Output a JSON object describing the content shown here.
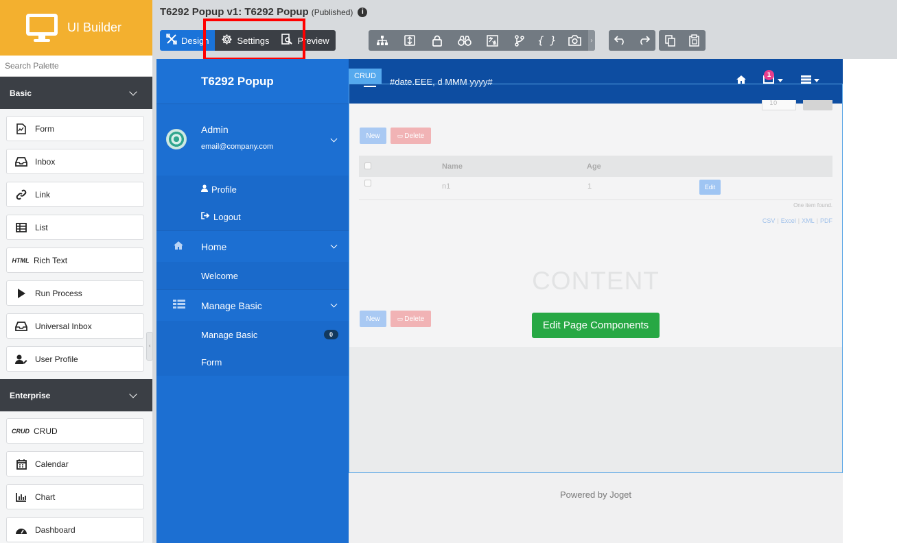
{
  "app": {
    "name": "UI Builder"
  },
  "header": {
    "title": "T6292 Popup v1: T6292 Popup",
    "status": "(Published)",
    "modes": [
      {
        "label": "Design",
        "icon": "design-icon",
        "active": true
      },
      {
        "label": "Settings",
        "icon": "gear-icon",
        "active": false
      },
      {
        "label": "Preview",
        "icon": "preview-icon",
        "active": false
      }
    ],
    "tools": [
      "tree-icon",
      "properties-icon",
      "permission-icon",
      "binoculars-icon",
      "translate-icon",
      "branch-icon",
      "json-icon",
      "screenshot-icon"
    ],
    "history": [
      "undo-icon",
      "redo-icon"
    ],
    "clipboard": [
      "copy-icon",
      "paste-icon"
    ]
  },
  "palette": {
    "search_placeholder": "Search Palette",
    "categories": [
      {
        "name": "Basic",
        "items": [
          {
            "label": "Form",
            "icon": "form-icon"
          },
          {
            "label": "Inbox",
            "icon": "inbox-icon"
          },
          {
            "label": "Link",
            "icon": "link-icon"
          },
          {
            "label": "List",
            "icon": "list-icon"
          },
          {
            "label": "Rich Text",
            "icon": "HTML"
          },
          {
            "label": "Run Process",
            "icon": "play-icon"
          },
          {
            "label": "Universal Inbox",
            "icon": "inbox-icon"
          },
          {
            "label": "User Profile",
            "icon": "user-edit-icon"
          }
        ]
      },
      {
        "name": "Enterprise",
        "items": [
          {
            "label": "CRUD",
            "icon": "CRUD"
          },
          {
            "label": "Calendar",
            "icon": "calendar-icon"
          },
          {
            "label": "Chart",
            "icon": "chart-icon"
          },
          {
            "label": "Dashboard",
            "icon": "dashboard-icon"
          }
        ]
      }
    ]
  },
  "userview": {
    "brand": "T6292 Popup",
    "user": {
      "name": "Admin",
      "email": "email@company.com"
    },
    "user_links": [
      "Profile",
      "Logout"
    ],
    "menus": [
      {
        "label": "Home",
        "icon": "home-icon",
        "children": [
          {
            "label": "Welcome"
          }
        ]
      },
      {
        "label": "Manage Basic",
        "icon": "table-icon",
        "children": [
          {
            "label": "Manage Basic",
            "badge": "0"
          },
          {
            "label": "Form"
          }
        ]
      }
    ],
    "date_text": "#date.EEE, d MMM yyyy#",
    "inbox_count": "1",
    "crud_tag": "CRUD",
    "crud": {
      "page_size": "10",
      "new_label": "New",
      "delete_label": "Delete",
      "columns": [
        "Name",
        "Age"
      ],
      "rows": [
        {
          "name": "n1",
          "age": "1",
          "action": "Edit"
        }
      ],
      "found_text": "One item found.",
      "exports": [
        "CSV",
        "Excel",
        "XML",
        "PDF"
      ]
    },
    "content_watermark": "CONTENT",
    "edit_button": "Edit Page Components",
    "footer": "Powered by Joget"
  }
}
